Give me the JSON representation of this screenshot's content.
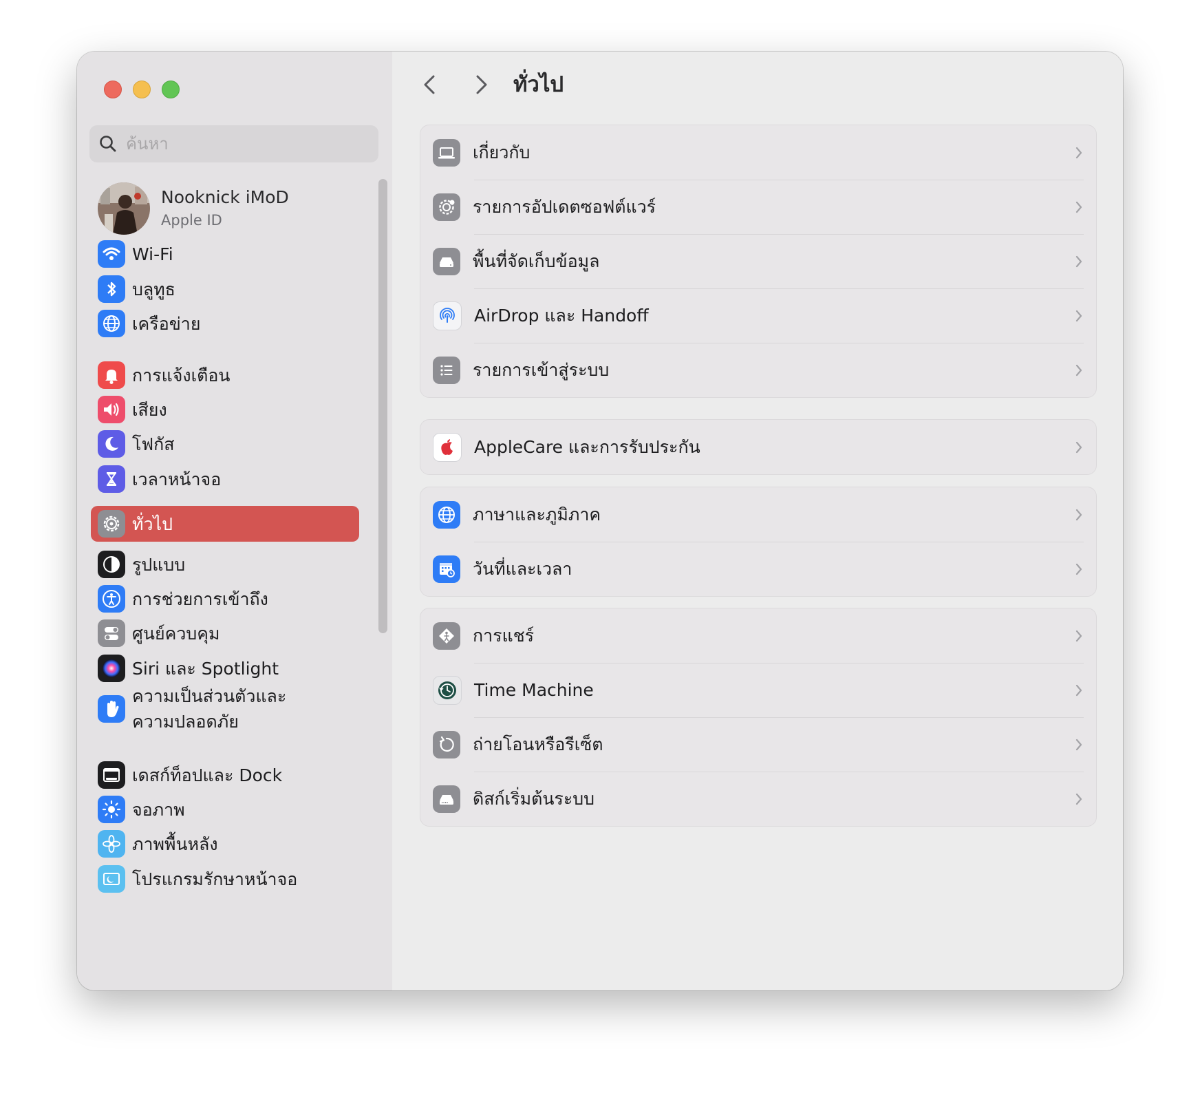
{
  "sidebar": {
    "search_placeholder": "ค้นหา",
    "profile": {
      "name": "Nooknick iMoD",
      "subtitle": "Apple ID"
    },
    "items": [
      {
        "label": "Wi-Fi",
        "icon": "wifi-icon",
        "color": "#2e7cf6"
      },
      {
        "label": "บลูทูธ",
        "icon": "bluetooth-icon",
        "color": "#2e7cf6"
      },
      {
        "label": "เครือข่าย",
        "icon": "globe-icon",
        "color": "#2e7cf6"
      },
      {
        "label": "การแจ้งเตือน",
        "icon": "bell-icon",
        "color": "#ef4b4b"
      },
      {
        "label": "เสียง",
        "icon": "speaker-icon",
        "color": "#ee4d6b"
      },
      {
        "label": "โฟกัส",
        "icon": "moon-icon",
        "color": "#5e5ce6"
      },
      {
        "label": "เวลาหน้าจอ",
        "icon": "hourglass-icon",
        "color": "#5e5ce6"
      },
      {
        "label": "ทั่วไป",
        "icon": "gear-icon",
        "color": "#8e8e93"
      },
      {
        "label": "รูปแบบ",
        "icon": "appearance-icon",
        "color": "#1d1d1f"
      },
      {
        "label": "การช่วยการเข้าถึง",
        "icon": "accessibility-icon",
        "color": "#2e7cf6"
      },
      {
        "label": "ศูนย์ควบคุม",
        "icon": "toggles-icon",
        "color": "#8e8e93"
      },
      {
        "label": "Siri และ Spotlight",
        "icon": "siri-icon",
        "color": "#1d1d1f"
      },
      {
        "label": "ความเป็นส่วนตัวและความปลอดภัย",
        "label_line1": "ความเป็นส่วนตัวและ",
        "label_line2": "ความปลอดภัย",
        "icon": "hand-icon",
        "color": "#2e7cf6"
      },
      {
        "label": "เดสก์ท็อปและ Dock",
        "icon": "dock-icon",
        "color": "#1d1d1f"
      },
      {
        "label": "จอภาพ",
        "icon": "sun-icon",
        "color": "#2e7cf6"
      },
      {
        "label": "ภาพพื้นหลัง",
        "icon": "flower-icon",
        "color": "#4fb4f0"
      },
      {
        "label": "โปรแกรมรักษาหน้าจอ",
        "icon": "screensaver-icon",
        "color": "#5bc0f0"
      }
    ],
    "active_index": 7
  },
  "main": {
    "title": "ทั่วไป",
    "groups": [
      [
        {
          "label": "เกี่ยวกับ",
          "icon": "laptop-icon"
        },
        {
          "label": "รายการอัปเดตซอฟต์แวร์",
          "icon": "gear-badge-icon"
        },
        {
          "label": "พื้นที่จัดเก็บข้อมูล",
          "icon": "drive-icon"
        },
        {
          "label": "AirDrop และ Handoff",
          "icon": "airdrop-icon"
        },
        {
          "label": "รายการเข้าสู่ระบบ",
          "icon": "list-icon"
        }
      ],
      [
        {
          "label": "AppleCare และการรับประกัน",
          "icon": "apple-icon"
        }
      ],
      [
        {
          "label": "ภาษาและภูมิภาค",
          "icon": "globe-icon"
        },
        {
          "label": "วันที่และเวลา",
          "icon": "calendar-clock-icon"
        }
      ],
      [
        {
          "label": "การแชร์",
          "icon": "sharing-icon"
        },
        {
          "label": "Time Machine",
          "icon": "time-machine-icon"
        },
        {
          "label": "ถ่ายโอนหรือรีเซ็ต",
          "icon": "reset-icon"
        },
        {
          "label": "ดิสก์เริ่มต้นระบบ",
          "icon": "startup-disk-icon"
        }
      ]
    ]
  },
  "colors": {
    "accent": "#d35552",
    "sidebar_bg": "#e4e2e4",
    "content_bg": "#ececec"
  }
}
